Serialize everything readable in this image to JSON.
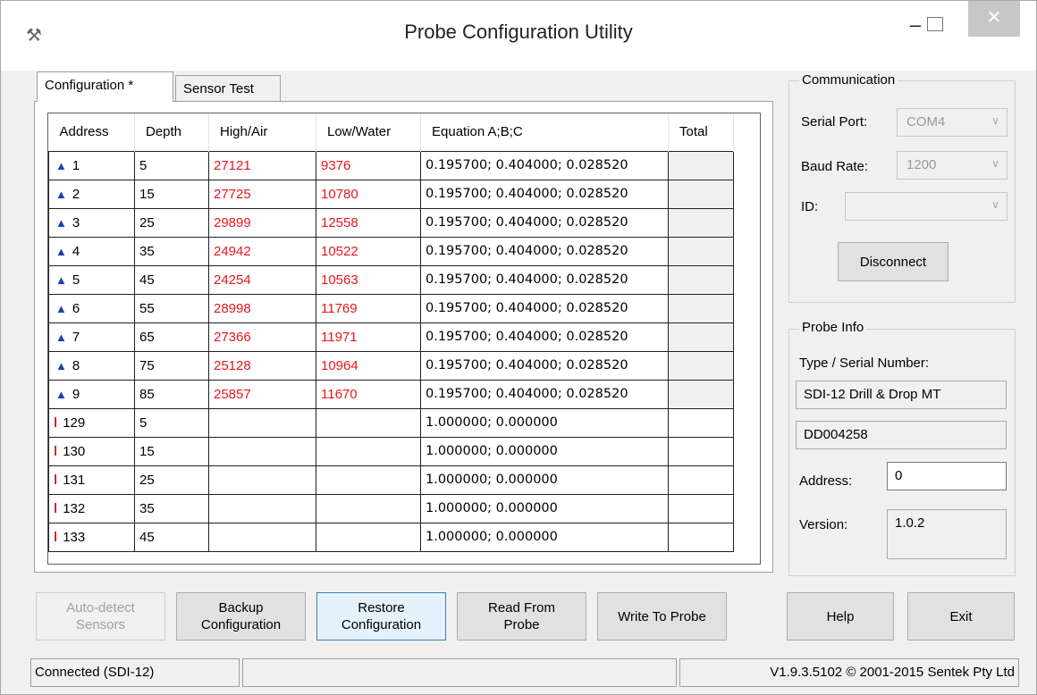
{
  "window": {
    "title": "Probe Configuration Utility",
    "minimize": "–",
    "close": "✕"
  },
  "tabs": [
    {
      "label": "Configuration *"
    },
    {
      "label": "Sensor Test"
    }
  ],
  "table": {
    "headers": [
      "Address",
      "Depth",
      "High/Air",
      "Low/Water",
      "Equation  A;B;C",
      "Total"
    ],
    "rows": [
      {
        "icon": "drop",
        "address": "1",
        "depth": "5",
        "high": "27121",
        "low": "9376",
        "eq": "0.195700; 0.404000; 0.028520"
      },
      {
        "icon": "drop",
        "address": "2",
        "depth": "15",
        "high": "27725",
        "low": "10780",
        "eq": "0.195700; 0.404000; 0.028520"
      },
      {
        "icon": "drop",
        "address": "3",
        "depth": "25",
        "high": "29899",
        "low": "12558",
        "eq": "0.195700; 0.404000; 0.028520"
      },
      {
        "icon": "drop",
        "address": "4",
        "depth": "35",
        "high": "24942",
        "low": "10522",
        "eq": "0.195700; 0.404000; 0.028520"
      },
      {
        "icon": "drop",
        "address": "5",
        "depth": "45",
        "high": "24254",
        "low": "10563",
        "eq": "0.195700; 0.404000; 0.028520"
      },
      {
        "icon": "drop",
        "address": "6",
        "depth": "55",
        "high": "28998",
        "low": "11769",
        "eq": "0.195700; 0.404000; 0.028520"
      },
      {
        "icon": "drop",
        "address": "7",
        "depth": "65",
        "high": "27366",
        "low": "11971",
        "eq": "0.195700; 0.404000; 0.028520"
      },
      {
        "icon": "drop",
        "address": "8",
        "depth": "75",
        "high": "25128",
        "low": "10964",
        "eq": "0.195700; 0.404000; 0.028520"
      },
      {
        "icon": "drop",
        "address": "9",
        "depth": "85",
        "high": "25857",
        "low": "11670",
        "eq": "0.195700; 0.404000; 0.028520"
      },
      {
        "icon": "thermometer",
        "address": "129",
        "depth": "5",
        "high": "",
        "low": "",
        "eq": "1.000000; 0.000000"
      },
      {
        "icon": "thermometer",
        "address": "130",
        "depth": "15",
        "high": "",
        "low": "",
        "eq": "1.000000; 0.000000"
      },
      {
        "icon": "thermometer",
        "address": "131",
        "depth": "25",
        "high": "",
        "low": "",
        "eq": "1.000000; 0.000000"
      },
      {
        "icon": "thermometer",
        "address": "132",
        "depth": "35",
        "high": "",
        "low": "",
        "eq": "1.000000; 0.000000"
      },
      {
        "icon": "thermometer",
        "address": "133",
        "depth": "45",
        "high": "",
        "low": "",
        "eq": "1.000000; 0.000000"
      }
    ]
  },
  "communication": {
    "title": "Communication",
    "serial_port_label": "Serial Port:",
    "serial_port_value": "COM4",
    "baud_rate_label": "Baud Rate:",
    "baud_rate_value": "1200",
    "id_label": "ID:",
    "id_value": "",
    "disconnect_label": "Disconnect"
  },
  "probe_info": {
    "title": "Probe Info",
    "type_serial_label": "Type / Serial Number:",
    "type_value": "SDI-12 Drill & Drop MT",
    "serial_value": "DD004258",
    "address_label": "Address:",
    "address_value": "0",
    "version_label": "Version:",
    "version_value": "1.0.2"
  },
  "buttons": {
    "autodetect": "Auto-detect Sensors",
    "backup": "Backup Configuration",
    "restore": "Restore Configuration",
    "read": "Read From Probe",
    "write": "Write To Probe",
    "help": "Help",
    "exit": "Exit"
  },
  "status": {
    "connection": "Connected (SDI-12)",
    "middle": "",
    "version": "V1.9.3.5102 © 2001-2015 Sentek Pty Ltd"
  },
  "colors": {
    "red_values": "#e8161c",
    "drop_icon": "#1a3fb5",
    "thermo_icon": "#c0161c"
  }
}
